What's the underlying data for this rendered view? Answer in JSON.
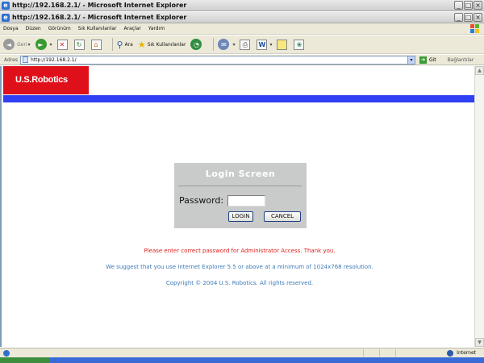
{
  "window": {
    "title": "http://192.168.2.1/ - Microsoft Internet Explorer",
    "buttons": {
      "minimize": "_",
      "maximize": "□",
      "close": "×"
    }
  },
  "menu": [
    "Dosya",
    "Düzen",
    "Görünüm",
    "Sık Kullanılanlar",
    "Araçlar",
    "Yardım"
  ],
  "toolbar": {
    "back_label": "Geri",
    "search_label": "Ara",
    "favorites_label": "Sık Kullanılanlar"
  },
  "address": {
    "label": "Adres",
    "value": "http://192.168.2.1/",
    "go_label": "Git",
    "links_label": "Bağlantılar"
  },
  "page": {
    "logo_text": "U.S.Robotics",
    "login": {
      "title": "Login  Screen",
      "password_label": "Password:",
      "password_value": "",
      "login_button": "LOGIN",
      "cancel_button": "CANCEL"
    },
    "error_message": "Please enter correct password for Administrator Access. Thank you.",
    "suggestion": "We suggest that you use Internet Explorer 5.5 or above at a minimum of 1024x768 resolution.",
    "copyright": "Copyright © 2004 U.S. Robotics. All rights reserved."
  },
  "status": {
    "zone": "Internet"
  },
  "colors": {
    "brand_red": "#e0101a",
    "blue_bar": "#2f3ff5",
    "error_red": "#e0201d",
    "info_blue": "#3e7ab6",
    "panel_gray": "#c9cbca"
  }
}
